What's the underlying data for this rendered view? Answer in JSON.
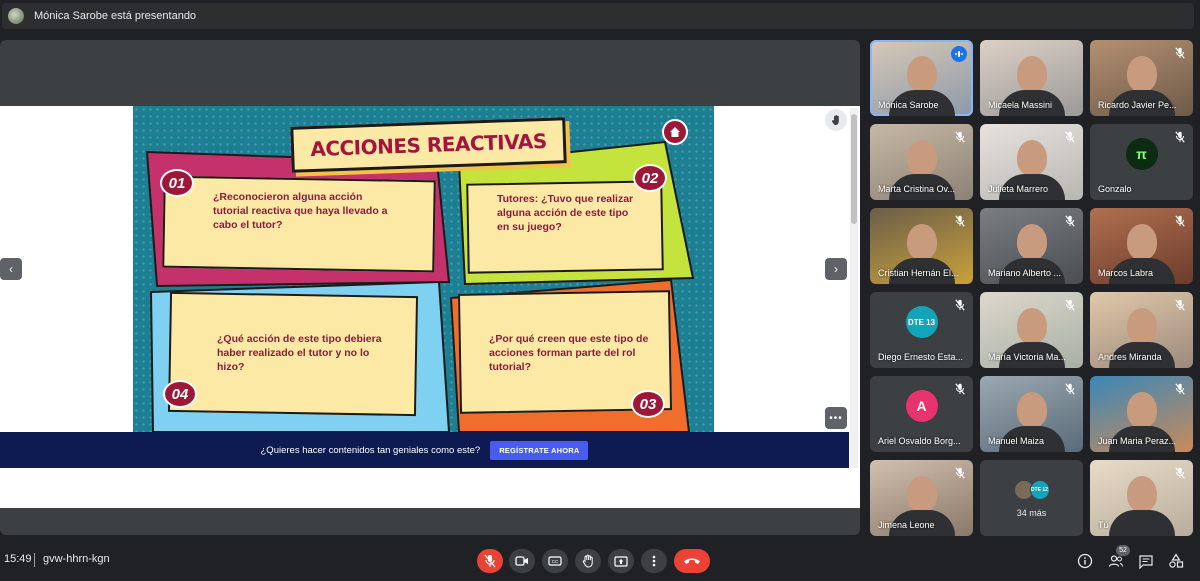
{
  "header": {
    "presenting_text": "Mónica Sarobe está presentando"
  },
  "slide": {
    "title": "ACCIONES REACTIVAS",
    "panels": [
      {
        "number": "01",
        "text": "¿Reconocieron alguna acción tutorial reactiva que haya llevado a cabo el tutor?"
      },
      {
        "number": "02",
        "text": "Tutores: ¿Tuvo que realizar alguna acción de este tipo en su juego?"
      },
      {
        "number": "04",
        "text": "¿Qué acción de este tipo debiera haber realizado el tutor y no lo hizo?"
      },
      {
        "number": "03",
        "text": "¿Por qué creen que este tipo de acciones forman parte del rol tutorial?"
      }
    ],
    "cta_text": "¿Quieres hacer contenidos tan geniales como este?",
    "cta_button": "REGÍSTRATE AHORA"
  },
  "participants": [
    {
      "name": "Mónica Sarobe",
      "state": "speaking",
      "video": true
    },
    {
      "name": "Micaela Massini",
      "state": "none",
      "video": true
    },
    {
      "name": "Ricardo Javier Pe...",
      "state": "muted",
      "video": true
    },
    {
      "name": "Marta Cristina Ov...",
      "state": "muted",
      "video": true
    },
    {
      "name": "Julieta Marrero",
      "state": "muted",
      "video": true
    },
    {
      "name": "Gonzalo",
      "state": "muted",
      "video": false,
      "avatar_text": "π",
      "avatar_color": "#0d2b12"
    },
    {
      "name": "Cristian Hernán El...",
      "state": "muted",
      "video": true
    },
    {
      "name": "Mariano Alberto ...",
      "state": "muted",
      "video": true
    },
    {
      "name": "Marcos Labra",
      "state": "muted",
      "video": true
    },
    {
      "name": "Diego Ernesto Esta...",
      "state": "muted",
      "video": false,
      "avatar_text": "DTE 13",
      "avatar_color": "#12a4b8"
    },
    {
      "name": "María Victoria Ma...",
      "state": "muted",
      "video": true
    },
    {
      "name": "Andres Miranda",
      "state": "muted",
      "video": true
    },
    {
      "name": "Ariel Osvaldo Borg...",
      "state": "muted",
      "video": false,
      "avatar_text": "A",
      "avatar_color": "#e8336f"
    },
    {
      "name": "Manuel Maiza",
      "state": "muted",
      "video": true
    },
    {
      "name": "Juan Maria Peraz...",
      "state": "muted",
      "video": true
    },
    {
      "name": "Jimena Leone",
      "state": "muted",
      "video": true
    },
    {
      "name": "",
      "state": "none",
      "video": false,
      "more_label": "34 más",
      "mini_avatar_text": "DTE 12"
    },
    {
      "name": "Tú",
      "state": "muted",
      "video": true
    }
  ],
  "toolbar": {
    "time": "15:49",
    "meeting_code": "gvw-hhrn-kgn",
    "participant_count": "52"
  },
  "colors": {
    "background": "#202124",
    "hangup": "#ea4335",
    "speaking": "#1a73e8",
    "slide_teal": "#1d7f93",
    "slide_crimson": "#9c1838",
    "cta_bar": "#0d1b52"
  }
}
